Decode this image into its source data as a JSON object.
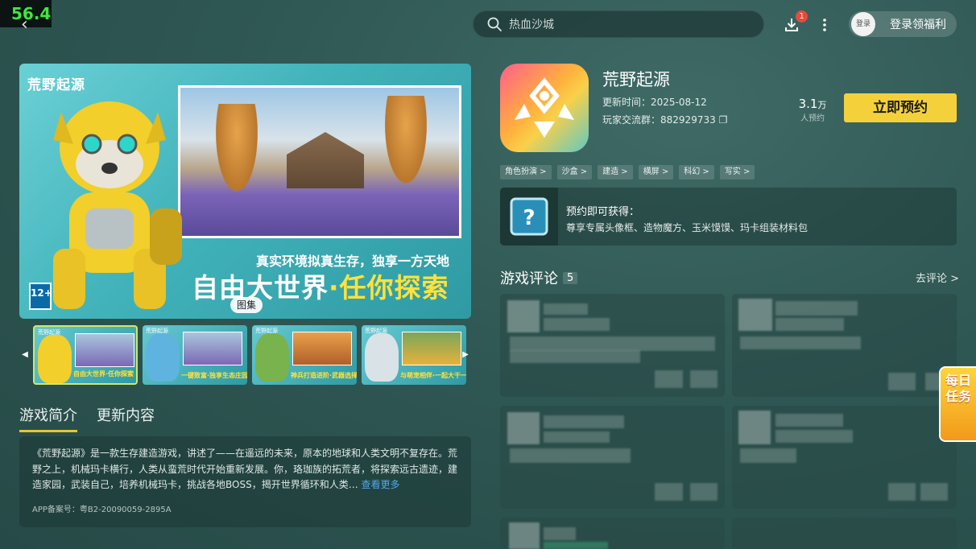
{
  "overlay": {
    "fps": "56.4"
  },
  "header": {
    "search_placeholder": "热血沙城",
    "download_badge": "1",
    "avatar_label": "登录",
    "login_label": "登录领福利"
  },
  "hero": {
    "logo_text": "荒野起源",
    "slogan_line1": "真实环境拟真生存，独享一方天地",
    "slogan_part1": "自由大世界",
    "slogan_sep": "·",
    "slogan_part2": "任你探索",
    "age_rating": "12+",
    "gallery_label": "图集"
  },
  "thumbnails": [
    {
      "logo": "荒野起源",
      "caption": "自由大世界·任你探索",
      "active": true
    },
    {
      "logo": "荒野起源",
      "caption": "一键致富·独享生态庄园",
      "active": false
    },
    {
      "logo": "荒野起源",
      "caption": "神兵打造进阶·武器选择",
      "active": false
    },
    {
      "logo": "荒野起源",
      "caption": "与萌宠相伴·一起大干一",
      "active": false
    }
  ],
  "tabs": [
    {
      "label": "游戏简介",
      "active": true
    },
    {
      "label": "更新内容",
      "active": false
    }
  ],
  "intro": {
    "text": "《荒野起源》是一款生存建造游戏，讲述了——在遥远的未来，原本的地球和人类文明不复存在。荒野之上，机械玛卡横行，人类从蛮荒时代开始重新发展。你，珞珈族的拓荒者，将探索远古遗迹，建造家园，武装自己，培养机械玛卡，挑战各地BOSS，揭开世界循环和人类…",
    "more_label": "查看更多",
    "icp": "APP备案号：粤B2-20090059-2895A"
  },
  "app": {
    "name": "荒野起源",
    "update_label": "更新时间：",
    "update_date": "2025-08-12",
    "group_label": "玩家交流群：",
    "group_id": "882929733",
    "reserve_count": "3.1",
    "reserve_unit": "万",
    "reserve_count_label": "人预约",
    "reserve_button": "立即预约",
    "tags": [
      "角色扮演 >",
      "沙盒 >",
      "建造 >",
      "横屏 >",
      "科幻 >",
      "写实 >"
    ]
  },
  "bonus": {
    "title": "预约即可获得：",
    "desc": "尊享专属头像框、造物魔方、玉米馍馍、玛卡组装材料包"
  },
  "reviews": {
    "title": "游戏评论",
    "count": "5",
    "go_label": "去评论 >"
  },
  "daily_task": {
    "label": "每日任务"
  },
  "colors": {
    "accent_yellow": "#f4d13b",
    "link_blue": "#55a6e8",
    "badge_red": "#e74a3b"
  }
}
